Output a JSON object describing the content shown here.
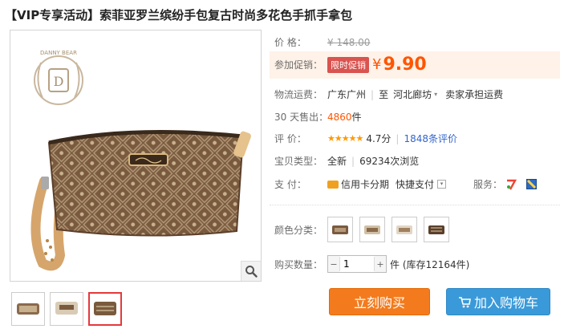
{
  "title": "【VIP专享活动】索菲亚罗兰缤纷手包复古时尚多花色手抓手拿包",
  "brand_logo_text": "DANNY BEAR",
  "price": {
    "label": "价      格：",
    "original": "¥ 148.00"
  },
  "promo": {
    "label": "参加促销：",
    "badge": "限时促销",
    "currency": "¥",
    "value": "9.90"
  },
  "shipping": {
    "label": "物流运费：",
    "from": "广东广州",
    "to_prefix": "至",
    "to": "河北廊坊",
    "note": "卖家承担运费"
  },
  "sales": {
    "label": "30 天售出：",
    "count": "4860",
    "unit": "件"
  },
  "rating": {
    "label": "评      价：",
    "stars": "★★★★★",
    "score": "4.7分",
    "reviews": "1848条评价"
  },
  "item_type": {
    "label": "宝贝类型：",
    "condition": "全新",
    "views": "69234次浏览"
  },
  "payment": {
    "label": "支      付：",
    "credit": "信用卡分期",
    "quick": "快捷支付",
    "service_label": "服务："
  },
  "color": {
    "label": "颜色分类："
  },
  "quantity": {
    "label": "购买数量：",
    "value": "1",
    "stock": "件 (库存12164件)"
  },
  "buttons": {
    "buy": "立刻购买",
    "cart": "加入购物车"
  },
  "colors": {
    "accent": "#ff5500",
    "buy": "#f37b1d",
    "cart": "#3a9ad9"
  }
}
